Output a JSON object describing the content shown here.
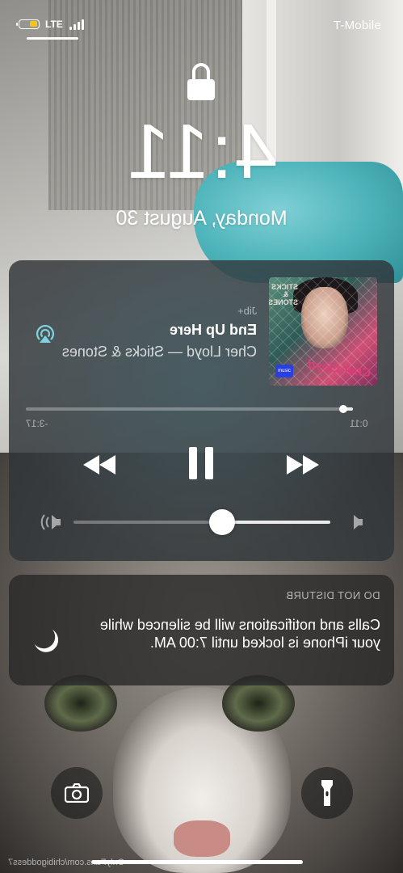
{
  "status_bar": {
    "carrier": "T-Mobile",
    "network": "LTE",
    "battery_level": 0.45
  },
  "lock_screen": {
    "time": "4:11",
    "date": "Monday, August 30"
  },
  "now_playing": {
    "source_app": "Jib+",
    "song_title": "End Up Here",
    "artist_album": "Cher Lloyd — Sticks & Stones",
    "elapsed": "0:11",
    "remaining": "-3:17",
    "progress": 0.03,
    "volume": 0.42,
    "album_art": {
      "title_text": "STICKS & STONES",
      "script_text": "Cher Lloyd",
      "badge": "music"
    },
    "icons": {
      "airplay": "airplay-icon",
      "rewind": "rewind-icon",
      "pause": "pause-icon",
      "fast_forward": "fast-forward-icon",
      "volume_low": "speaker-low-icon",
      "volume_high": "speaker-high-icon"
    },
    "colors": {
      "airplay_accent": "#7fd3e0"
    }
  },
  "dnd_notification": {
    "title": "DO NOT DISTURB",
    "body": "Calls and notifications will be silenced while your iPhone is locked until 7:00 AM."
  },
  "bottom": {
    "camera_icon": "camera-icon",
    "flashlight_icon": "flashlight-icon",
    "watermark": "OnlyFans.com/chibigoddess7"
  }
}
